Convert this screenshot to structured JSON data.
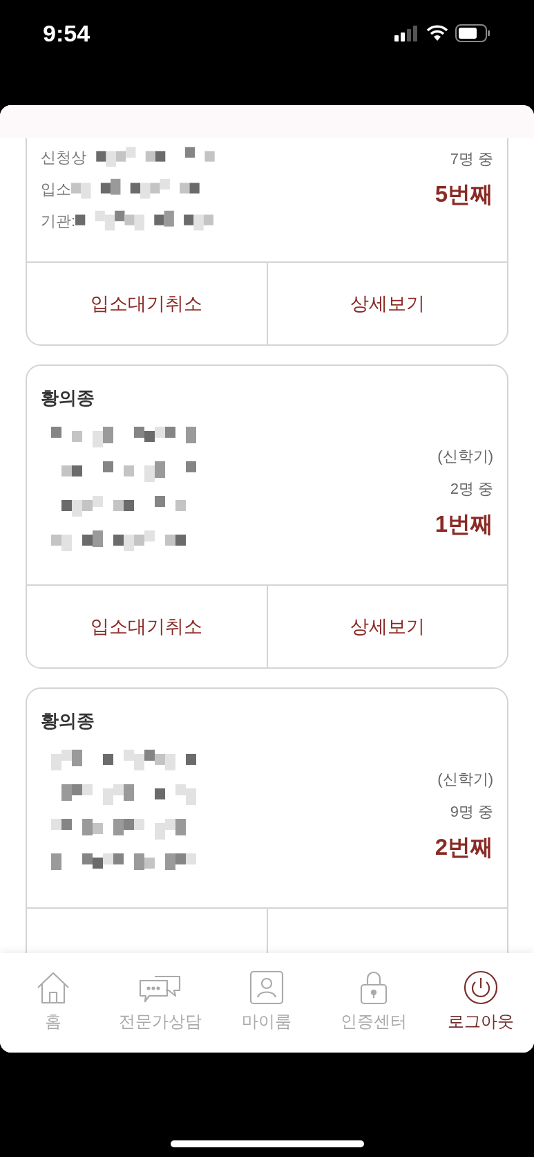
{
  "status_bar": {
    "time": "9:54"
  },
  "cards": [
    {
      "detail_lines": [
        {
          "kind": "labeled",
          "label": "신청상"
        },
        {
          "kind": "labeled",
          "label": "입소"
        },
        {
          "kind": "labeled",
          "label": "기관:"
        }
      ],
      "count": "7명 중",
      "rank": "5번째",
      "actions": [
        "입소대기취소",
        "상세보기"
      ]
    },
    {
      "name": "황의종",
      "detail_lines": [
        {
          "kind": "redacted"
        },
        {
          "kind": "redacted"
        },
        {
          "kind": "redacted"
        },
        {
          "kind": "redacted"
        }
      ],
      "term": "(신학기)",
      "count": "2명 중",
      "rank": "1번째",
      "actions": [
        "입소대기취소",
        "상세보기"
      ]
    },
    {
      "name": "황의종",
      "detail_lines": [
        {
          "kind": "redacted"
        },
        {
          "kind": "redacted"
        },
        {
          "kind": "redacted"
        },
        {
          "kind": "redacted"
        }
      ],
      "term": "(신학기)",
      "count": "9명 중",
      "rank": "2번째"
    }
  ],
  "bottom_nav": [
    {
      "kind": "home",
      "label": "홈",
      "selected": false
    },
    {
      "kind": "chat",
      "label": "전문가상담",
      "selected": false
    },
    {
      "kind": "person",
      "label": "마이룸",
      "selected": false
    },
    {
      "kind": "lock",
      "label": "인증센터",
      "selected": false
    },
    {
      "kind": "power",
      "label": "로그아웃",
      "selected": true
    }
  ]
}
